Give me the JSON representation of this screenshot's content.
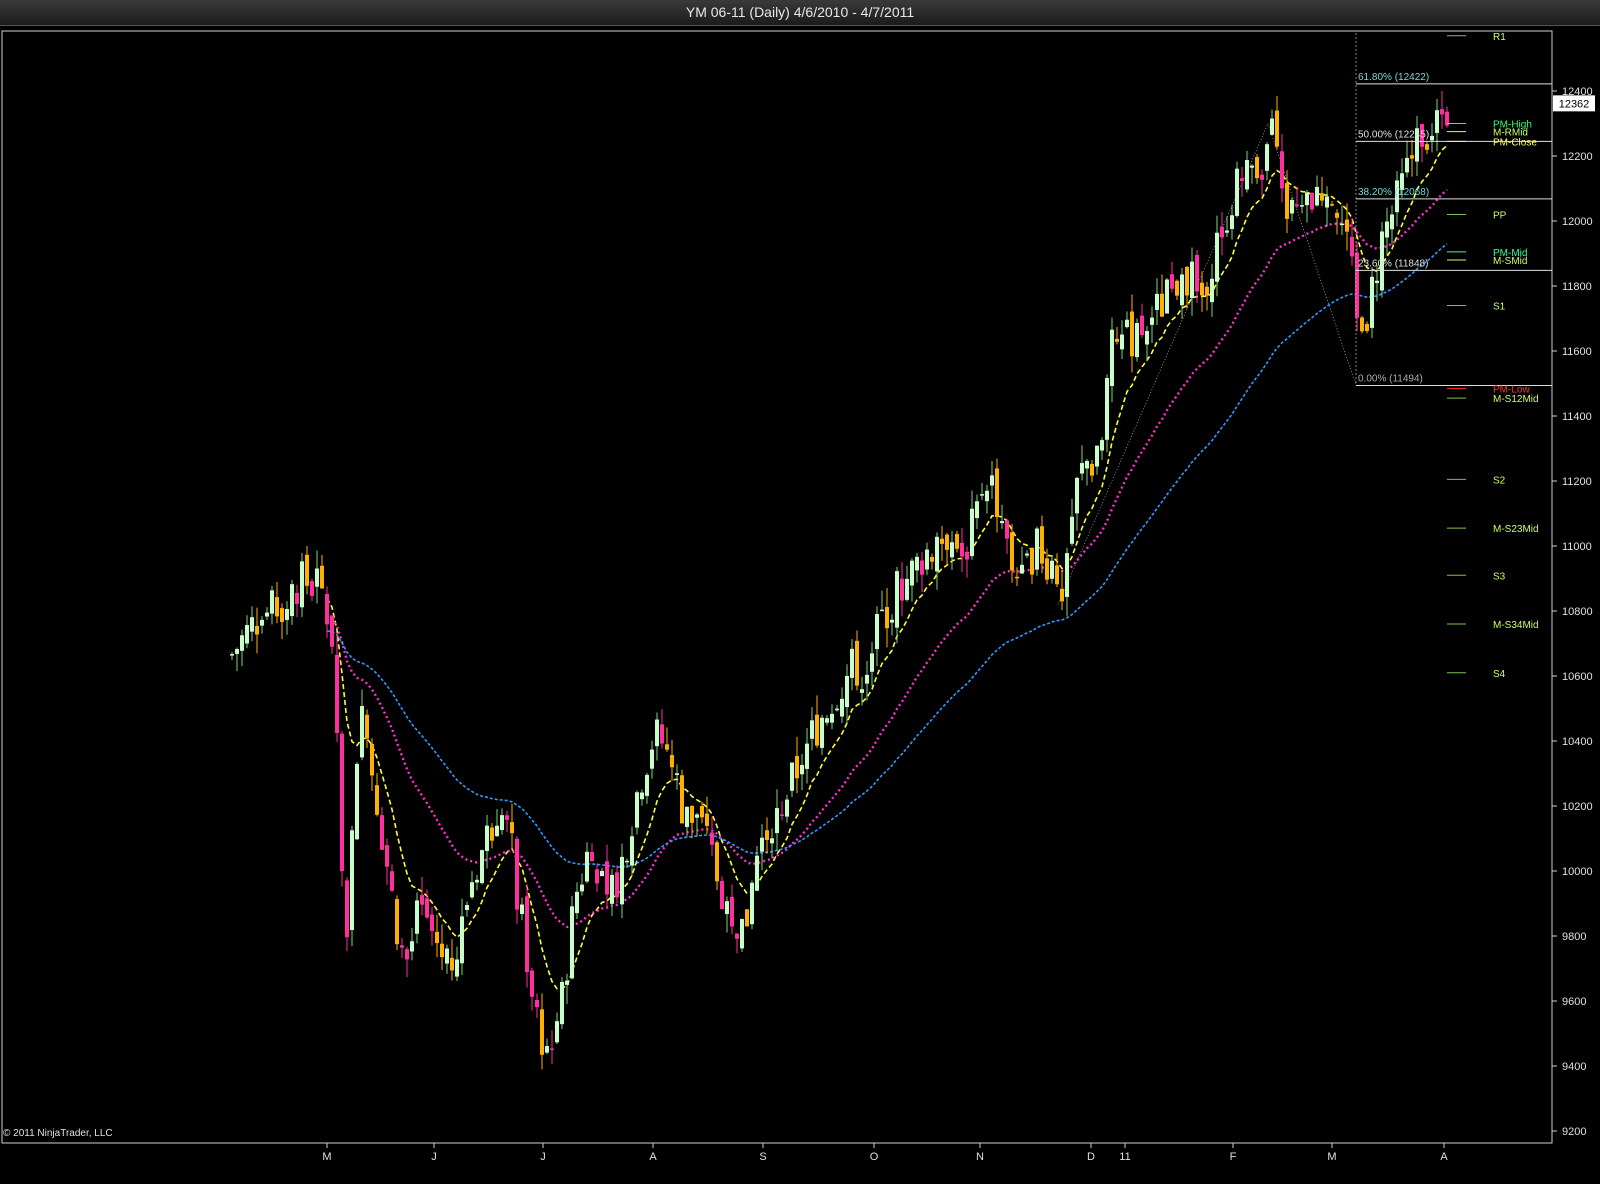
{
  "window": {
    "title": "YM 06-11 (Daily)  4/6/2010 - 4/7/2011"
  },
  "copyright": "© 2011 NinjaTrader, LLC",
  "colors": {
    "up": "#c8ffc8",
    "up_wick": "#7fd27f",
    "down": "#ffb000",
    "down_alt": "#ff2fa0",
    "ema_fast": "#ffff33",
    "ema_mid": "#ff33cc",
    "ema_slow": "#3399ff",
    "fib": "#7fd4d4",
    "pivot_line": "#7fc24a",
    "pivot_label": "#c8ff66"
  },
  "chart_data": {
    "type": "candlestick",
    "title": "YM 06-11 (Daily)",
    "date_range": "4/6/2010 - 4/7/2011",
    "ylim": [
      9200,
      12600
    ],
    "y_ticks": [
      9200,
      9400,
      9600,
      9800,
      10000,
      10200,
      10400,
      10600,
      10800,
      11000,
      11200,
      11400,
      11600,
      11800,
      12000,
      12200,
      12400
    ],
    "x_ticks": [
      "M",
      "J",
      "J",
      "A",
      "S",
      "O",
      "N",
      "D",
      "11",
      "F",
      "M",
      "A"
    ],
    "last_price": "12362",
    "fib_levels": [
      {
        "label": "61.80% (12422)",
        "value": 12422
      },
      {
        "label": "50.00% (12245)",
        "value": 12245
      },
      {
        "label": "38.20% (12068)",
        "value": 12068
      },
      {
        "label": "23.60% (11848)",
        "value": 11848
      },
      {
        "label": "0.00% (11494)",
        "value": 11494
      }
    ],
    "pivot_levels": [
      {
        "label": "R1",
        "value": 12570
      },
      {
        "label": "PM-High",
        "value": 12300
      },
      {
        "label": "M-RMid",
        "value": 12275
      },
      {
        "label": "PM-Close",
        "value": 12245
      },
      {
        "label": "PP",
        "value": 12020
      },
      {
        "label": "PM-Mid",
        "value": 11905
      },
      {
        "label": "M-SMid",
        "value": 11880
      },
      {
        "label": "S1",
        "value": 11740
      },
      {
        "label": "PM-Low",
        "value": 11485
      },
      {
        "label": "M-S12Mid",
        "value": 11455
      },
      {
        "label": "S2",
        "value": 11205
      },
      {
        "label": "M-S23Mid",
        "value": 11055
      },
      {
        "label": "S3",
        "value": 10910
      },
      {
        "label": "M-S34Mid",
        "value": 10760
      },
      {
        "label": "S4",
        "value": 10610
      }
    ]
  }
}
